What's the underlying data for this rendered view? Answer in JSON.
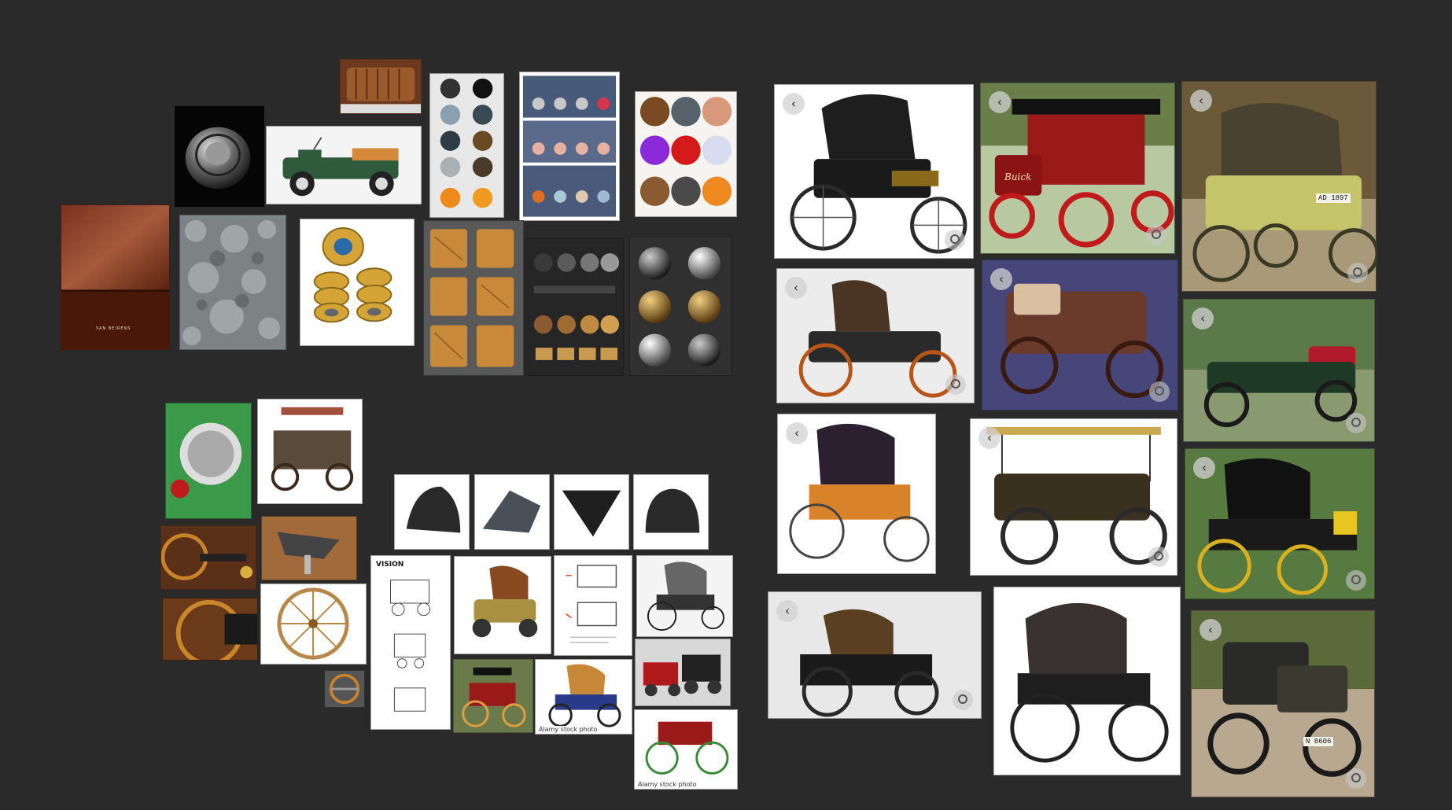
{
  "board": {
    "background": "#2a2a2a",
    "nav_icon": "chevron-left-icon",
    "nav_glyph": "‹",
    "lens_icon": "visual-search-icon"
  },
  "texts": {
    "buick_badge": "Buick",
    "plate_1": "AD 1897",
    "plate_2": "N 8606",
    "vision_label": "VISION",
    "brand_text": "VAN BEIRENS",
    "caption_a": "Alamy stock photo",
    "caption_b": "Alamy stock photo"
  },
  "tiles": [
    {
      "id": "leather-seat-photo",
      "kind": "photo"
    },
    {
      "id": "metal-knob-photo",
      "kind": "photo"
    },
    {
      "id": "toy-truck-photo",
      "kind": "photo"
    },
    {
      "id": "brown-leather-swatch",
      "kind": "texture"
    },
    {
      "id": "hammered-metal-texture",
      "kind": "texture"
    },
    {
      "id": "brass-bearings-photo",
      "kind": "photo"
    },
    {
      "id": "material-spheres-chart",
      "kind": "reference"
    },
    {
      "id": "material-grid-sheet",
      "kind": "reference"
    },
    {
      "id": "wood-metal-spheres",
      "kind": "reference"
    },
    {
      "id": "wood-grain-sheet",
      "kind": "reference"
    },
    {
      "id": "material-presets-sheet",
      "kind": "reference"
    },
    {
      "id": "metal-spheres-sheet",
      "kind": "reference"
    },
    {
      "id": "veteran-car-1",
      "kind": "search-result"
    },
    {
      "id": "buick-red-car",
      "kind": "search-result"
    },
    {
      "id": "olive-veteran-car",
      "kind": "search-result"
    },
    {
      "id": "veteran-car-museum",
      "kind": "search-result"
    },
    {
      "id": "veteran-car-purple-bg",
      "kind": "search-result"
    },
    {
      "id": "green-open-car",
      "kind": "search-result"
    },
    {
      "id": "orange-carriage",
      "kind": "search-result"
    },
    {
      "id": "surrey-top-car",
      "kind": "search-result"
    },
    {
      "id": "black-yellow-carriage",
      "kind": "search-result"
    },
    {
      "id": "museum-carriage-2",
      "kind": "search-result"
    },
    {
      "id": "black-hood-carriage",
      "kind": "search-result"
    },
    {
      "id": "dark-veteran-car",
      "kind": "search-result"
    },
    {
      "id": "green-headlight-photo",
      "kind": "photo"
    },
    {
      "id": "rusty-vehicle-photo",
      "kind": "photo"
    },
    {
      "id": "steering-photo-1",
      "kind": "photo"
    },
    {
      "id": "seat-mechanism-photo",
      "kind": "photo"
    },
    {
      "id": "steering-photo-2",
      "kind": "photo"
    },
    {
      "id": "wooden-wheel-photo",
      "kind": "photo"
    },
    {
      "id": "steering-wheel-small",
      "kind": "photo"
    },
    {
      "id": "hood-render-1",
      "kind": "reference"
    },
    {
      "id": "hood-render-2",
      "kind": "reference"
    },
    {
      "id": "hood-render-3",
      "kind": "reference"
    },
    {
      "id": "hood-render-4",
      "kind": "reference"
    },
    {
      "id": "blueprint-sheet",
      "kind": "reference"
    },
    {
      "id": "gold-car-render",
      "kind": "reference"
    },
    {
      "id": "hood-diagram",
      "kind": "reference"
    },
    {
      "id": "bw-carriage-drawing",
      "kind": "reference"
    },
    {
      "id": "red-carriage-photo",
      "kind": "photo"
    },
    {
      "id": "blue-carriage-drawing",
      "kind": "reference"
    },
    {
      "id": "showroom-cars-photo",
      "kind": "photo"
    },
    {
      "id": "green-wheel-carriage",
      "kind": "reference"
    }
  ]
}
